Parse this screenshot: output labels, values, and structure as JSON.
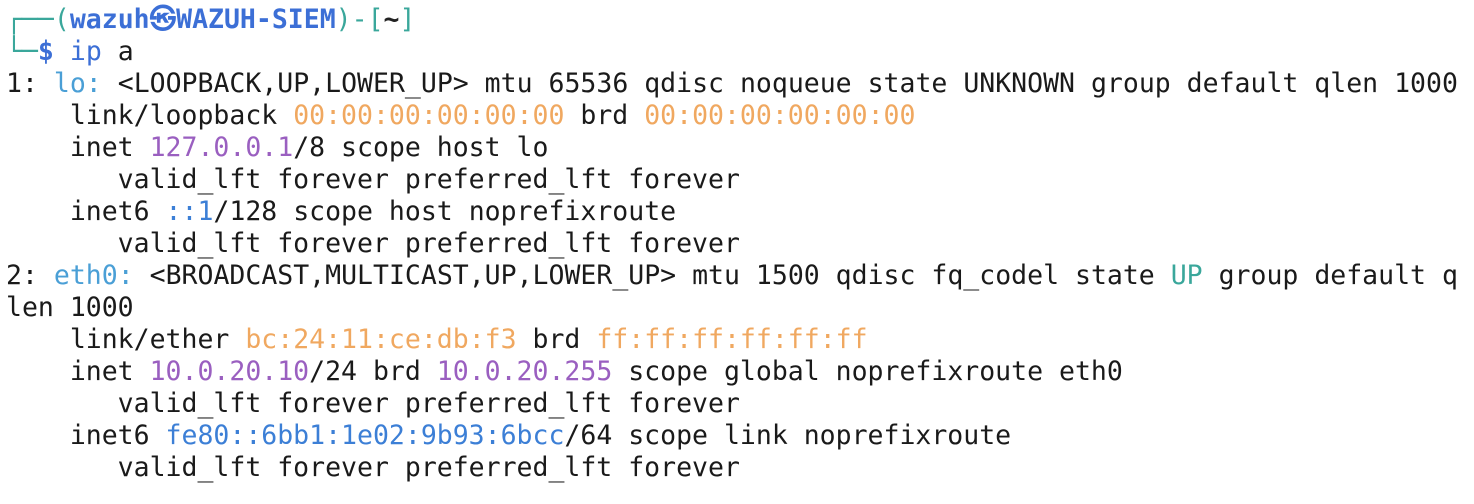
{
  "prompt": {
    "frame_top_left": "┌──(",
    "user": "wazuh",
    "at_symbol": "㉿",
    "host": "WAZUH-SIEM",
    "frame_mid": ")-[",
    "cwd": "~",
    "frame_end": "]",
    "frame_bottom_left": "└─",
    "dollar": "$",
    "command_name": "ip",
    "command_arg": "a"
  },
  "output": {
    "lo": {
      "index": "1:",
      "name": "lo:",
      "flags_line": "<LOOPBACK,UP,LOWER_UP> mtu 65536 qdisc noqueue state UNKNOWN group default qlen 1000",
      "link_prefix": "    link/loopback ",
      "link_mac": "00:00:00:00:00:00",
      "link_brd": " brd ",
      "link_brd_mac": "00:00:00:00:00:00",
      "inet_prefix": "    inet ",
      "inet_addr": "127.0.0.1",
      "inet_suffix": "/8 scope host lo",
      "inet_valid": "       valid_lft forever preferred_lft forever",
      "inet6_prefix": "    inet6 ",
      "inet6_addr": "::1",
      "inet6_suffix": "/128 scope host noprefixroute",
      "inet6_valid": "       valid_lft forever preferred_lft forever"
    },
    "eth0": {
      "index": "2:",
      "name": "eth0:",
      "flags_pre": "<BROADCAST,MULTICAST,UP,LOWER_UP> mtu 1500 qdisc fq_codel state ",
      "state": "UP",
      "flags_post": " group default q",
      "wrap": "len 1000",
      "link_prefix": "    link/ether ",
      "link_mac": "bc:24:11:ce:db:f3",
      "link_brd": " brd ",
      "link_brd_mac": "ff:ff:ff:ff:ff:ff",
      "inet_prefix": "    inet ",
      "inet_addr": "10.0.20.10",
      "inet_mid": "/24 brd ",
      "inet_brd": "10.0.20.255",
      "inet_suffix": " scope global noprefixroute eth0",
      "inet_valid": "       valid_lft forever preferred_lft forever",
      "inet6_prefix": "    inet6 ",
      "inet6_addr": "fe80::6bb1:1e02:9b93:6bcc",
      "inet6_suffix": "/64 scope link noprefixroute",
      "inet6_valid": "       valid_lft forever preferred_lft forever"
    }
  },
  "colors": {
    "frame": "#3aa79b",
    "user_host": "#3c6fd6",
    "interface": "#4a9fd6",
    "mac": "#f0a860",
    "ipv4": "#9a5fc0",
    "ipv6": "#3c7fd6",
    "state_up": "#3aa79b",
    "text": "#1a1a1a",
    "background": "#ffffff"
  }
}
